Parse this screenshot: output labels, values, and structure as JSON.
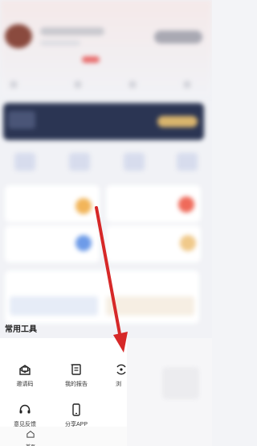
{
  "tools_section": {
    "title": "常用工具",
    "items": [
      {
        "label": "邀请码",
        "icon": "invite-code-icon"
      },
      {
        "label": "我的报告",
        "icon": "report-icon"
      },
      {
        "label": "浏",
        "icon": "browse-icon"
      },
      {
        "label": "意见反馈",
        "icon": "headset-icon"
      },
      {
        "label": "分享APP",
        "icon": "phone-icon"
      }
    ]
  },
  "tabbar": {
    "home_label": "首页",
    "home_icon": "home-icon"
  },
  "colors": {
    "arrow": "#d62828",
    "banner": "#2b3553",
    "accent_gold": "#d9b46d"
  }
}
